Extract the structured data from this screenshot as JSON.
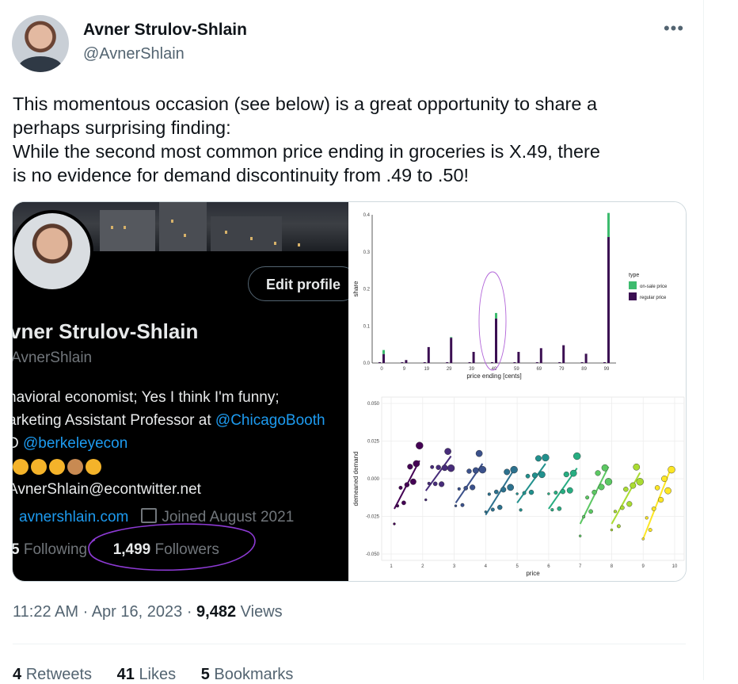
{
  "author": {
    "name": "Avner Strulov-Shlain",
    "handle": "@AvnerShlain",
    "more_icon": "more-horizontal-icon"
  },
  "tweet": {
    "lines": [
      "This momentous occasion (see below) is a great opportunity to share a",
      "perhaps surprising finding:",
      "While the second most common price ending in groceries is X.49, there",
      "is no evidence for demand discontinuity from .49 to .50!"
    ],
    "time": "11:22 AM",
    "date": "Apr 16, 2023",
    "views_count": "9,482",
    "views_label": "Views",
    "sep": "·",
    "retweets_count": "4",
    "retweets_label": "Retweets",
    "likes_count": "41",
    "likes_label": "Likes",
    "bookmarks_count": "5",
    "bookmarks_label": "Bookmarks"
  },
  "profile_screenshot": {
    "edit_button": "Edit profile",
    "name": "vner Strulov-Shlain",
    "handle": "AvnerShlain",
    "bio1": "havioral economist; Yes I think I'm funny;",
    "bio2_pre": "arketing Assistant Professor at ",
    "bio2_link": "@ChicagoBooth",
    "bio3_pre": "D ",
    "bio3_link": "@berkeleyecon",
    "bio5": "AvnerShlain@econtwitter.net",
    "website": "avnershlain.com",
    "joined": "Joined August 2021",
    "following_count": "5",
    "following_label": "Following",
    "followers_count": "1,499",
    "followers_label": "Followers"
  },
  "chart_data": [
    {
      "type": "bar",
      "xlabel": "price ending [cents]",
      "ylabel": "share",
      "ylim": [
        0,
        0.4
      ],
      "yticks": [
        "0.0",
        "0.1",
        "0.2",
        "0.3",
        "0.4"
      ],
      "legend_title": "type",
      "legend_position": "right",
      "categories": [
        "0",
        "9",
        "19",
        "29",
        "39",
        "49",
        "59",
        "69",
        "79",
        "89",
        "99"
      ],
      "series": [
        {
          "name": "on-sale price",
          "color": "#3dbb6e",
          "values": [
            0.035,
            0.004,
            0.0,
            0.07,
            0.0,
            0.135,
            0.0,
            0.0,
            0.0,
            0.0,
            0.405
          ]
        },
        {
          "name": "regular price",
          "color": "#3b0f52",
          "values": [
            0.024,
            0.008,
            0.043,
            0.068,
            0.03,
            0.12,
            0.03,
            0.04,
            0.048,
            0.025,
            0.34
          ]
        }
      ]
    },
    {
      "type": "scatter",
      "xlabel": "price",
      "ylabel": "demeaned demand",
      "xlim": [
        1,
        10
      ],
      "ylim": [
        -0.05,
        0.05
      ],
      "xticks": [
        "1",
        "2",
        "3",
        "4",
        "5",
        "6",
        "7",
        "8",
        "9",
        "10"
      ],
      "yticks": [
        "-0.050",
        "-0.025",
        "0.000",
        "0.025",
        "0.050"
      ],
      "grid": true,
      "colors": [
        "#440154",
        "#472c7a",
        "#3b518b",
        "#2c718e",
        "#21908d",
        "#27ad81",
        "#5cc863",
        "#aadc32",
        "#fde725"
      ],
      "lines": [
        {
          "x": [
            1.1,
            1.9
          ],
          "y": [
            -0.02,
            0.012
          ]
        },
        {
          "x": [
            2.1,
            2.9
          ],
          "y": [
            -0.008,
            0.015
          ]
        },
        {
          "x": [
            3.05,
            3.9
          ],
          "y": [
            -0.016,
            0.01
          ]
        },
        {
          "x": [
            4.0,
            4.9
          ],
          "y": [
            -0.024,
            0.006
          ]
        },
        {
          "x": [
            5.0,
            5.9
          ],
          "y": [
            -0.016,
            0.01
          ]
        },
        {
          "x": [
            6.0,
            6.9
          ],
          "y": [
            -0.02,
            0.007
          ]
        },
        {
          "x": [
            7.0,
            7.9
          ],
          "y": [
            -0.03,
            0.008
          ]
        },
        {
          "x": [
            8.0,
            8.9
          ],
          "y": [
            -0.03,
            0.004
          ]
        },
        {
          "x": [
            9.0,
            9.9
          ],
          "y": [
            -0.04,
            0.008
          ]
        }
      ]
    }
  ]
}
